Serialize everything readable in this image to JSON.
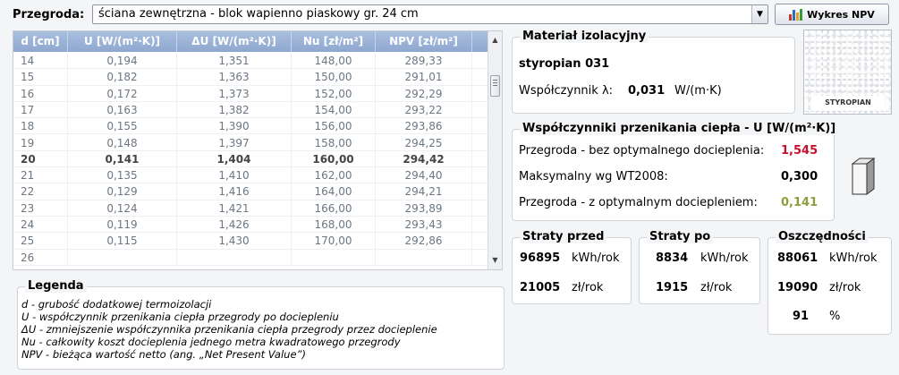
{
  "header": {
    "przegroda_label": "Przegroda:",
    "przegroda_value": "ściana zewnętrzna - blok wapienno piaskowy gr. 24 cm",
    "npv_button": "Wykres NPV"
  },
  "grid": {
    "columns": [
      "d [cm]",
      "U [W/(m²·K)]",
      "ΔU [W/(m²·K)]",
      "Nu [zł/m²]",
      "NPV [zł/m²]"
    ],
    "rows": [
      [
        "14",
        "0,194",
        "1,351",
        "148,00",
        "289,33"
      ],
      [
        "15",
        "0,182",
        "1,363",
        "150,00",
        "291,01"
      ],
      [
        "16",
        "0,172",
        "1,373",
        "152,00",
        "292,29"
      ],
      [
        "17",
        "0,163",
        "1,382",
        "154,00",
        "293,22"
      ],
      [
        "18",
        "0,155",
        "1,390",
        "156,00",
        "293,86"
      ],
      [
        "19",
        "0,148",
        "1,397",
        "158,00",
        "294,25"
      ],
      [
        "20",
        "0,141",
        "1,404",
        "160,00",
        "294,42"
      ],
      [
        "21",
        "0,135",
        "1,410",
        "162,00",
        "294,40"
      ],
      [
        "22",
        "0,129",
        "1,416",
        "164,00",
        "294,21"
      ],
      [
        "23",
        "0,124",
        "1,421",
        "166,00",
        "293,89"
      ],
      [
        "24",
        "0,119",
        "1,426",
        "168,00",
        "293,43"
      ],
      [
        "25",
        "0,115",
        "1,430",
        "170,00",
        "292,86"
      ],
      [
        "26",
        "",
        "",
        "",
        ""
      ]
    ],
    "selected_row": 6
  },
  "legend": {
    "title": "Legenda",
    "lines": [
      "d - grubość dodatkowej termoizolacji",
      "U - współczynnik przenikania ciepła przegrody po dociepleniu",
      "ΔU - zmniejszenie współczynnika przenikania ciepła przegrody przez docieplenie",
      "Nu - całkowity koszt docieplenia jednego metra kwadratowego przegrody",
      "NPV - bieżąca wartość netto (ang. „Net Present Value”)"
    ]
  },
  "material": {
    "title": "Materiał izolacyjny",
    "name": "styropian 031",
    "lambda_label": "Współczynnik λ:",
    "lambda_value": "0,031",
    "lambda_unit": "W/(m·K)",
    "image_tag": "STYROPIAN"
  },
  "u_coeffs": {
    "title": "Współczynniki przenikania ciepła - U [W/(m²·K)]",
    "row1_label": "Przegroda - bez optymalnego docieplenia:",
    "row1_value": "1,545",
    "row2_label": "Maksymalny wg WT2008:",
    "row2_value": "0,300",
    "row3_label": "Przegroda - z optymalnym dociepleniem:",
    "row3_value": "0,141",
    "colors": {
      "row1": "#c8102e",
      "row3": "#8e9c3c"
    }
  },
  "straty_przed": {
    "title": "Straty przed",
    "v1": "96895",
    "u1": "kWh/rok",
    "v2": "21005",
    "u2": "zł/rok"
  },
  "straty_po": {
    "title": "Straty po",
    "v1": "8834",
    "u1": "kWh/rok",
    "v2": "1915",
    "u2": "zł/rok"
  },
  "oszczednosci": {
    "title": "Oszczędności",
    "v1": "88061",
    "u1": "kWh/rok",
    "v2": "19090",
    "u2": "zł/rok",
    "v3": "91",
    "u3": "%"
  },
  "icons": [
    "chevron-down-icon",
    "bar-chart-icon",
    "scroll-up-icon",
    "scroll-down-icon",
    "wall-icon"
  ]
}
